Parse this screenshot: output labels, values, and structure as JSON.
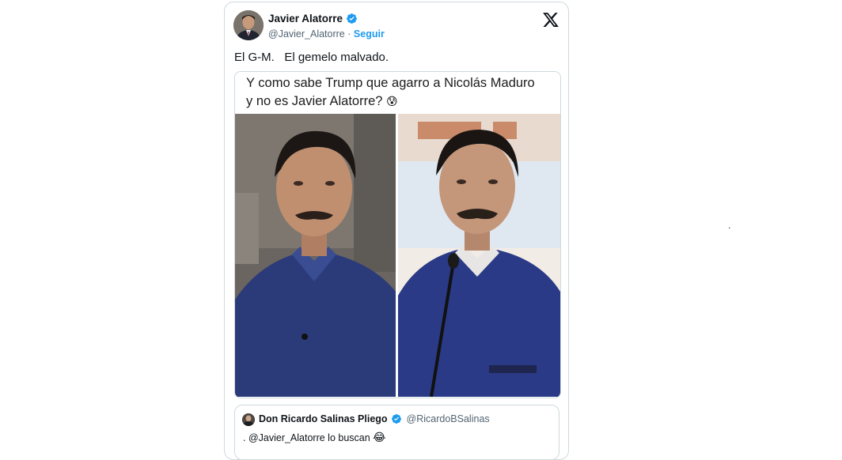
{
  "tweet": {
    "author_name": "Javier Alatorre",
    "handle": "@Javier_Alatorre",
    "separator": "·",
    "follow_label": "Seguir",
    "text": "El G-M.   El gemelo malvado."
  },
  "media": {
    "caption_line1": "Y como sabe Trump que agarro a Nicolás Maduro",
    "caption_line2": "y no es Javier Alatorre?",
    "caption_emoji": "😰"
  },
  "quoted_tweet": {
    "author_name": "Don Ricardo Salinas Pliego",
    "handle": "@RicardoBSalinas",
    "text": ". @Javier_Alatorre lo buscan",
    "emoji": "😂"
  },
  "stray_mark": ".",
  "icons": {
    "platform": "x-logo-icon",
    "verified": "verified-badge-icon"
  },
  "colors": {
    "link_blue": "#1d9bf0",
    "verified_blue": "#1d9bf0",
    "border": "#cfd9de",
    "secondary_text": "#536471"
  }
}
